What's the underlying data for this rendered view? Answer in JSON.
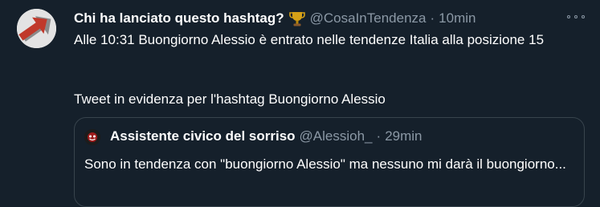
{
  "tweet": {
    "author_name": "Chi ha lanciato questo hashtag?",
    "author_handle": "@CosaInTendenza",
    "separator": "·",
    "time": "10min",
    "body_line1": "Alle 10:31 Buongiorno Alessio è entrato nelle tendenze Italia alla posizione 15",
    "body_line2": "Tweet in evidenza per l'hashtag Buongiorno Alessio",
    "badge_icon": "trophy-icon",
    "menu_icon": "more-icon"
  },
  "quoted_tweet": {
    "author_name": "Assistente civico del sorriso",
    "author_handle": "@Alessioh_",
    "separator": "·",
    "time": "29min",
    "text": "Sono in tendenza con \"buongiorno Alessio\" ma nessuno mi darà il buongiorno..."
  },
  "colors": {
    "background": "#15202b",
    "secondary_text": "#8b98a5",
    "border": "#38444d",
    "trophy": "#d4a017",
    "avatar_arrow": "#c0392b"
  }
}
